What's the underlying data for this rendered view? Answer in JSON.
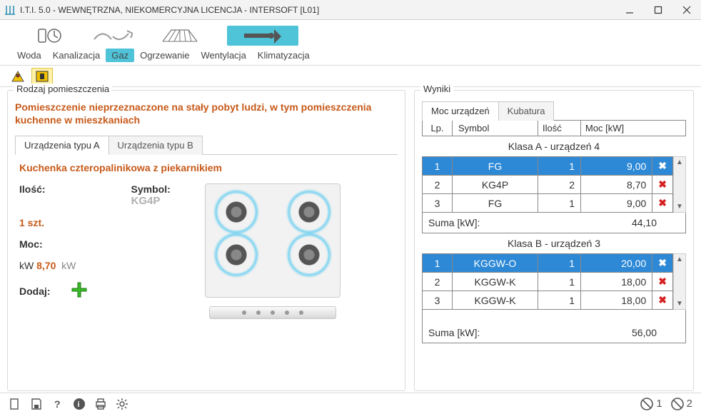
{
  "window": {
    "title": "I.T.I. 5.0 - WEWNĘTRZNA, NIEKOMERCYJNA LICENCJA - INTERSOFT [L01]"
  },
  "toolbar": {
    "labels": [
      "Woda",
      "Kanalizacja",
      "Gaz",
      "Ogrzewanie",
      "Wentylacja",
      "Klimatyzacja"
    ],
    "active_index": 2
  },
  "left": {
    "legend": "Rodzaj pomieszczenia",
    "heading": "Pomieszczenie nieprzeznaczone na stały pobyt ludzi, w tym pomieszczenia kuchenne w mieszkaniach",
    "tabs": [
      "Urządzenia typu A",
      "Urządzenia typu B"
    ],
    "tab_active": 0,
    "device_name": "Kuchenka czteropalinikowa z piekarnikiem",
    "labels": {
      "ilosc": "Ilość:",
      "symbol": "Symbol:",
      "moc": "Moc:",
      "dodaj": "Dodaj:"
    },
    "values": {
      "sztuk": "1 szt.",
      "symbol": "KG4P",
      "moc_unit_left": "kW",
      "moc_value": "8,70",
      "moc_unit_right": "kW"
    }
  },
  "right": {
    "legend": "Wyniki",
    "tabs": [
      "Moc urządzeń",
      "Kubatura"
    ],
    "tab_active": 0,
    "header": {
      "lp": "Lp.",
      "symbol": "Symbol",
      "ilosc": "Ilość",
      "moc": "Moc [kW]"
    },
    "classA": {
      "title": "Klasa A - urządzeń 4",
      "rows": [
        {
          "lp": "1",
          "symbol": "FG",
          "ilosc": "1",
          "moc": "9,00",
          "selected": true
        },
        {
          "lp": "2",
          "symbol": "KG4P",
          "ilosc": "2",
          "moc": "8,70",
          "selected": false
        },
        {
          "lp": "3",
          "symbol": "FG",
          "ilosc": "1",
          "moc": "9,00",
          "selected": false
        }
      ],
      "sum_label": "Suma [kW]:",
      "sum_value": "44,10"
    },
    "classB": {
      "title": "Klasa B - urządzeń 3",
      "rows": [
        {
          "lp": "1",
          "symbol": "KGGW-O",
          "ilosc": "1",
          "moc": "20,00",
          "selected": true
        },
        {
          "lp": "2",
          "symbol": "KGGW-K",
          "ilosc": "1",
          "moc": "18,00",
          "selected": false
        },
        {
          "lp": "3",
          "symbol": "KGGW-K",
          "ilosc": "1",
          "moc": "18,00",
          "selected": false
        }
      ],
      "sum_label": "Suma [kW]:",
      "sum_value": "56,00"
    }
  },
  "status": {
    "left_num": "1",
    "right_num": "2"
  }
}
